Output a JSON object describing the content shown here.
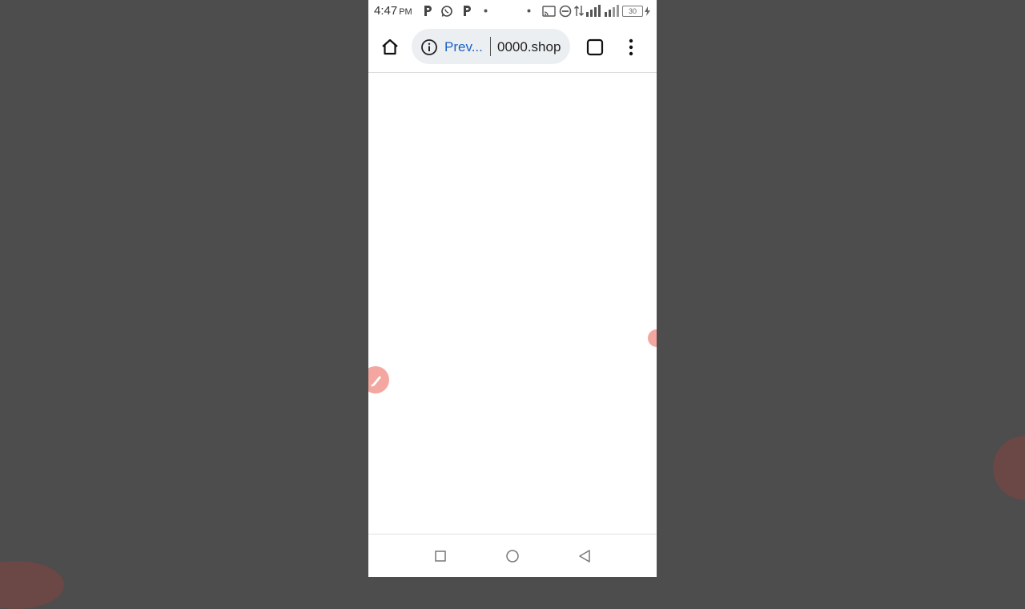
{
  "status_bar": {
    "time": "4:47",
    "ampm": "PM",
    "battery": "30"
  },
  "toolbar": {
    "page_info_label": "Prev...",
    "url": "0000.shop"
  },
  "icons": {
    "home": "home-icon",
    "info": "info-icon",
    "tabs": "tab-switcher-icon",
    "menu": "more-vert-icon",
    "recents": "square-icon",
    "home_nav": "circle-icon",
    "back": "triangle-back-icon",
    "edit": "pencil-icon"
  },
  "colors": {
    "backdrop": "#4d4d4d",
    "link_blue": "#1a62c7",
    "omnibox_bg": "#eceff1",
    "accent_dot": "#f4a6a0"
  }
}
